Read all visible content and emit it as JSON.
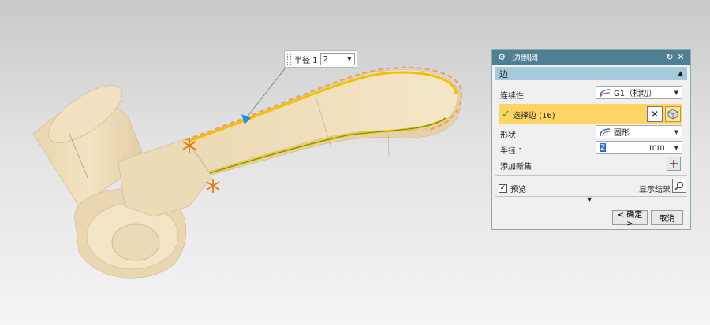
{
  "callout": {
    "label": "半径 1",
    "value": "2"
  },
  "dialog": {
    "title": "边倒圆",
    "section_edge": "边",
    "continuity": {
      "label": "连续性",
      "value": "G1（相切）"
    },
    "select_edge": {
      "label": "选择边 (16)"
    },
    "shape": {
      "label": "形状",
      "value": "圆形"
    },
    "radius": {
      "label": "半径 1",
      "value": "2",
      "unit": "mm"
    },
    "add_new_set": {
      "label": "添加新集"
    },
    "preview": {
      "label": "预览",
      "checked": true
    },
    "show_result": {
      "label": "显示结果"
    },
    "ok_label": "< 确定 >",
    "cancel_label": "取消"
  },
  "colors": {
    "titlebar": "#4f7f93",
    "section": "#a6cad9",
    "selection": "#ffd466",
    "part": "#f1dfb9",
    "highlight_edge": "#f3c000",
    "preview_edge": "#f0a060"
  },
  "icons": {
    "title": "settings-gear-icon",
    "reset": "reset-icon",
    "close": "close-icon",
    "continuity": "g1-continuity-icon",
    "shape": "circular-shape-icon",
    "deselect": "deselect-x-icon",
    "select_face": "cube-select-icon",
    "add_set": "add-set-icon",
    "show_result": "magnifier-icon",
    "expand": "expand-more-icon"
  }
}
